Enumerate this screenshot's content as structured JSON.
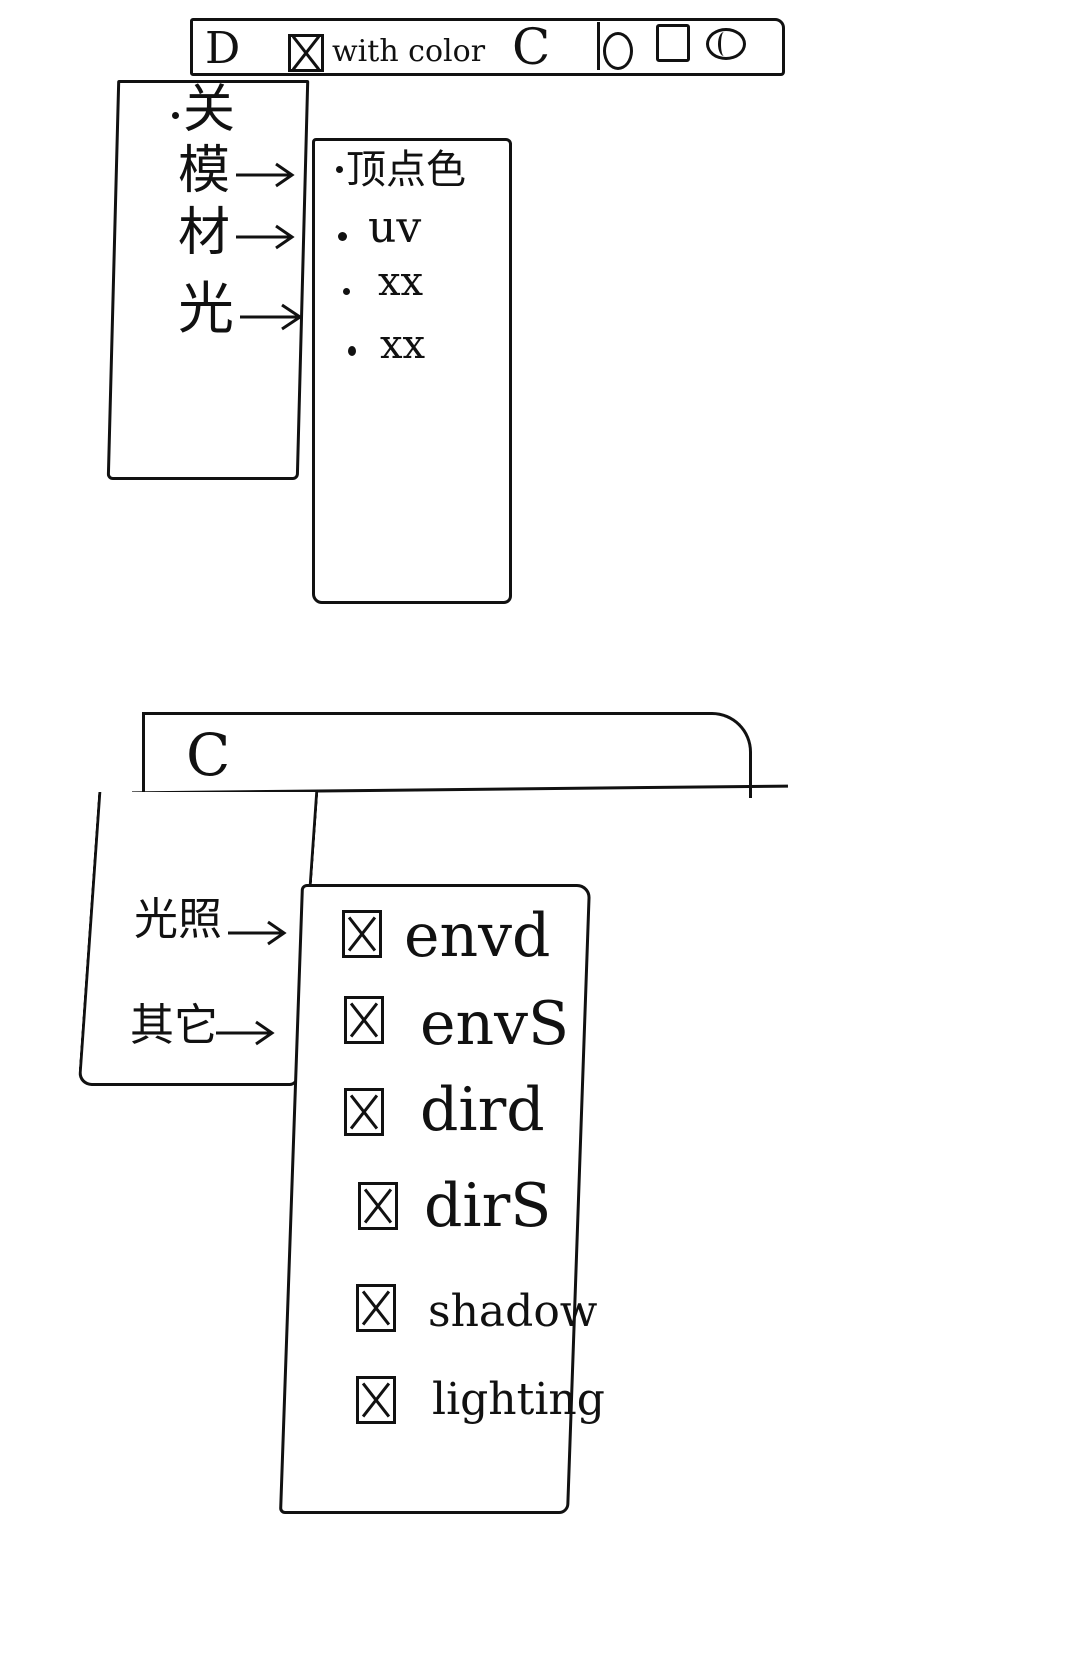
{
  "toolbar_top": {
    "d_label": "D",
    "with_color_label": "with color",
    "with_color_checked": true,
    "c_label": "C",
    "icons": [
      "ellipse-icon",
      "rectangle-icon",
      "sphere-icon"
    ]
  },
  "menu_top": {
    "items": [
      {
        "label": "关",
        "has_bullet": true,
        "has_arrow": false
      },
      {
        "label": "模",
        "has_bullet": false,
        "has_arrow": true
      },
      {
        "label": "材",
        "has_bullet": false,
        "has_arrow": true
      },
      {
        "label": "光",
        "has_bullet": false,
        "has_arrow": true
      }
    ]
  },
  "submenu_top": {
    "items": [
      "顶点色",
      "uv",
      "xx",
      "xx"
    ]
  },
  "toolbar_bottom": {
    "c_label": "C"
  },
  "menu_bottom": {
    "items": [
      {
        "label": "光照"
      },
      {
        "label": "其它"
      }
    ]
  },
  "submenu_bottom": {
    "items": [
      {
        "label": "envd",
        "checked": true
      },
      {
        "label": "envS",
        "checked": true
      },
      {
        "label": "dird",
        "checked": true
      },
      {
        "label": "dirS",
        "checked": true
      },
      {
        "label": "shadow",
        "checked": true
      },
      {
        "label": "lighting",
        "checked": true
      }
    ]
  }
}
